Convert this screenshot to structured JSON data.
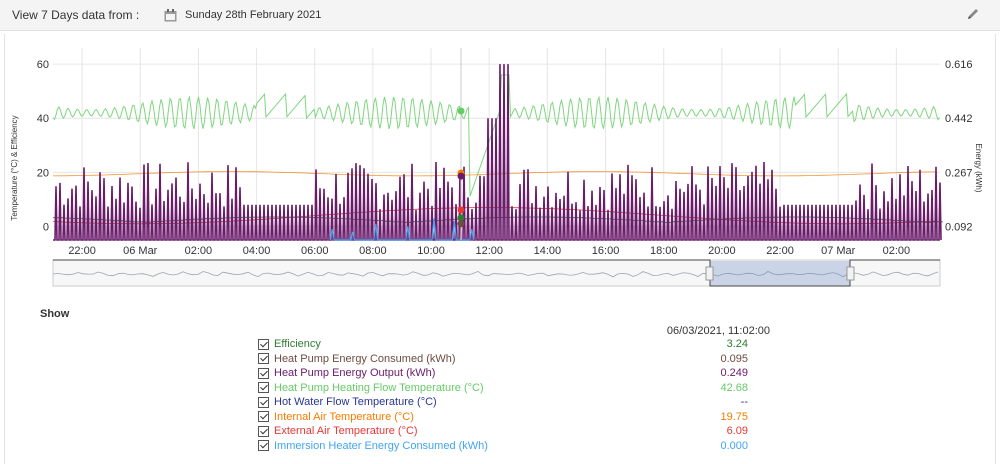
{
  "header": {
    "view_label": "View 7 Days data from :",
    "date_text": "Sunday 28th February 2021"
  },
  "show": {
    "title": "Show",
    "timestamp": "06/03/2021, 11:02:00"
  },
  "legend": [
    {
      "name": "Efficiency",
      "value": "3.24",
      "color": "#2e7d32"
    },
    {
      "name": "Heat Pump Energy Consumed (kWh)",
      "value": "0.095",
      "color": "#6d4c41"
    },
    {
      "name": "Heat Pump Energy Output (kWh)",
      "value": "0.249",
      "color": "#6a1b6a"
    },
    {
      "name": "Heat Pump Heating Flow Temperature (°C)",
      "value": "42.68",
      "color": "#66cc66"
    },
    {
      "name": "Hot Water Flow Temperature (°C)",
      "value": "--",
      "color": "#283593"
    },
    {
      "name": "Internal Air Temperature (°C)",
      "value": "19.75",
      "color": "#f57c00"
    },
    {
      "name": "External Air Temperature (°C)",
      "value": "6.09",
      "color": "#e53935"
    },
    {
      "name": "Immersion Heater Energy Consumed (kWh)",
      "value": "0.000",
      "color": "#42a5f5"
    }
  ],
  "chart_data": {
    "type": "line",
    "x_tick_labels": [
      "22:00",
      "06 Mar",
      "02:00",
      "04:00",
      "06:00",
      "08:00",
      "10:00",
      "12:00",
      "14:00",
      "16:00",
      "18:00",
      "20:00",
      "22:00",
      "07 Mar",
      "02:00"
    ],
    "x_range_hours": [
      -3,
      27.5
    ],
    "y_left": {
      "label": "Temperature (°C) & Efficiency",
      "ticks": [
        0,
        20,
        40,
        60
      ],
      "range": [
        -5,
        63
      ]
    },
    "y_right": {
      "label": "Energy (kWh)",
      "ticks": [
        "0.092",
        "0.267",
        "0.442",
        "0.616"
      ]
    },
    "grid": true,
    "crosshair_hour": 11.03,
    "series": [
      {
        "name": "Heat Pump Heating Flow Temperature (°C)",
        "color": "#66cc66",
        "baseline": 42,
        "amplitude": 6
      },
      {
        "name": "Heat Pump Energy Output (kWh)",
        "color": "#6a1b6a",
        "peak_left_units": 60,
        "typical_peak": 22
      },
      {
        "name": "Internal Air Temperature (°C)",
        "color": "#f57c00",
        "level": 19.75
      },
      {
        "name": "External Air Temperature (°C)",
        "color": "#e53935",
        "range": [
          1,
          10
        ]
      },
      {
        "name": "Efficiency",
        "color": "#2e7d32",
        "range": [
          1,
          3.5
        ]
      },
      {
        "name": "Immersion Heater Energy Consumed (kWh)",
        "color": "#42a5f5",
        "peak_left_units": 8
      }
    ]
  }
}
